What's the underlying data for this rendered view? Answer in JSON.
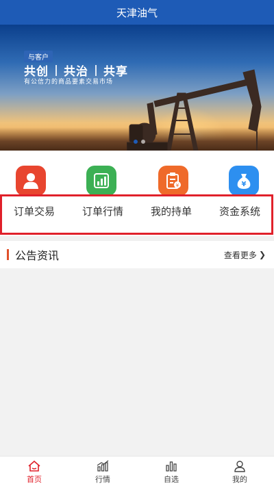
{
  "header": {
    "title": "天津油气"
  },
  "banner": {
    "badge": "与客户",
    "slogan": [
      "共创",
      "共治",
      "共享"
    ],
    "subtitle": "有公信力的商品要素交易市场"
  },
  "menu": [
    {
      "label": "订单交易",
      "icon": "person-icon",
      "color": "#e8452f"
    },
    {
      "label": "订单行情",
      "icon": "chart-icon",
      "color": "#3cb054"
    },
    {
      "label": "我的持单",
      "icon": "clipboard-icon",
      "color": "#ef6a2a"
    },
    {
      "label": "资金系统",
      "icon": "money-bag-icon",
      "color": "#2d8ff0"
    }
  ],
  "notice": {
    "title": "公告资讯",
    "more": "查看更多"
  },
  "tabbar": [
    {
      "label": "首页",
      "icon": "home-icon",
      "active": true
    },
    {
      "label": "行情",
      "icon": "market-chart-icon",
      "active": false
    },
    {
      "label": "自选",
      "icon": "bar-chart-icon",
      "active": false
    },
    {
      "label": "我的",
      "icon": "user-icon",
      "active": false
    }
  ],
  "colors": {
    "header": "#1e5bb6",
    "accent": "#e0202a"
  }
}
